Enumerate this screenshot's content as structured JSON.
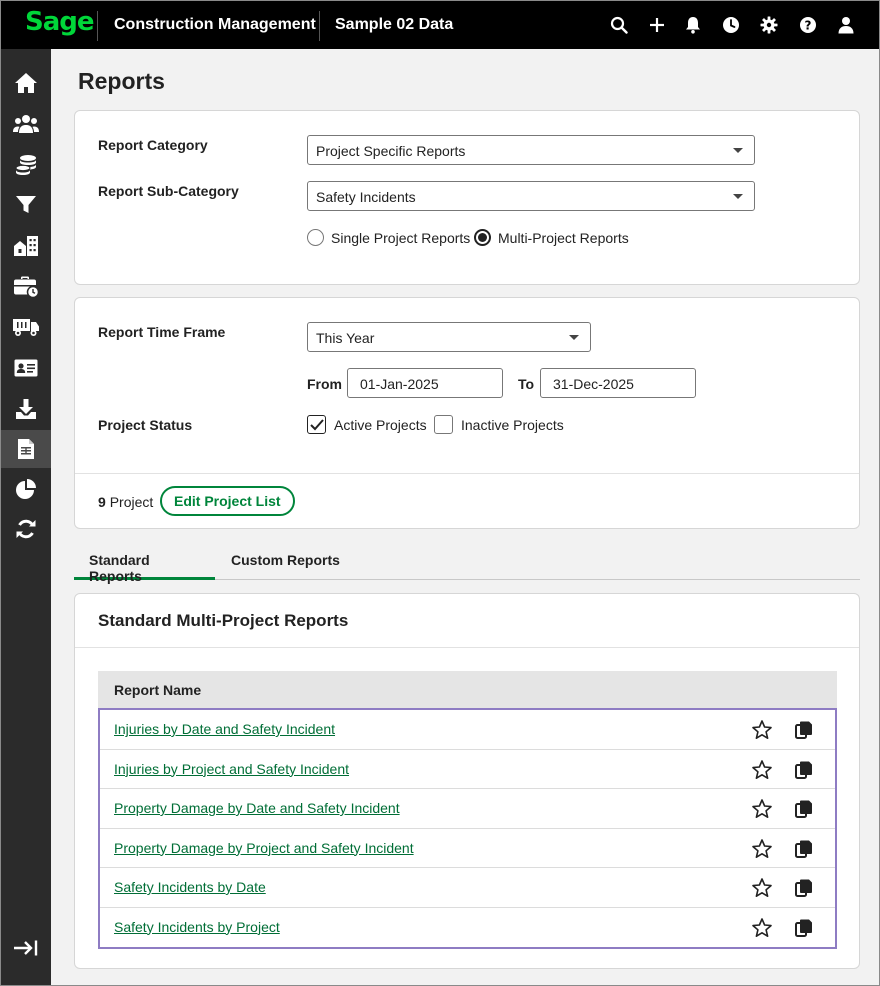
{
  "header": {
    "logo": "Sage",
    "app_name": "Construction Management",
    "company": "Sample 02 Data",
    "icons": [
      "search-icon",
      "plus-icon",
      "bell-icon",
      "clock-icon",
      "gear-icon",
      "help-icon",
      "user-icon"
    ]
  },
  "sidebar": {
    "items": [
      {
        "icon": "home-icon"
      },
      {
        "icon": "people-icon"
      },
      {
        "icon": "coins-icon"
      },
      {
        "icon": "filter-icon"
      },
      {
        "icon": "buildings-icon"
      },
      {
        "icon": "briefcase-clock-icon"
      },
      {
        "icon": "truck-icon"
      },
      {
        "icon": "id-card-icon"
      },
      {
        "icon": "download-icon"
      },
      {
        "icon": "report-icon",
        "active": true
      },
      {
        "icon": "pie-chart-icon"
      },
      {
        "icon": "refresh-icon"
      }
    ],
    "collapse_icon": "collapse-icon"
  },
  "page": {
    "title": "Reports"
  },
  "category_card": {
    "category_label": "Report Category",
    "category_value": "Project Specific Reports",
    "subcategory_label": "Report Sub-Category",
    "subcategory_value": "Safety Incidents",
    "radio_single": "Single Project Reports",
    "radio_multi": "Multi-Project Reports",
    "selected_radio": "Multi-Project Reports"
  },
  "timeframe_card": {
    "timeframe_label": "Report Time Frame",
    "timeframe_value": "This Year",
    "from_label": "From",
    "from_value": "01-Jan-2025",
    "to_label": "To",
    "to_value": "31-Dec-2025",
    "status_label": "Project Status",
    "active_label": "Active Projects",
    "active_checked": true,
    "inactive_label": "Inactive Projects",
    "inactive_checked": false,
    "project_count": "9",
    "project_count_suffix": "Project",
    "edit_button": "Edit Project List"
  },
  "tabs": {
    "standard": "Standard Reports",
    "custom": "Custom Reports",
    "active": "Standard Reports"
  },
  "reports_card": {
    "title": "Standard Multi-Project Reports",
    "column_header": "Report Name",
    "rows": [
      "Injuries by Date and Safety Incident",
      "Injuries by Project and Safety Incident",
      "Property Damage by Date and Safety Incident",
      "Property Damage by Project and Safety Incident",
      "Safety Incidents by Date",
      "Safety Incidents by Project"
    ]
  },
  "colors": {
    "brand_green": "#00d639",
    "accent_green": "#00853b",
    "link_green": "#006e36",
    "highlight_border": "#8e7cc3"
  }
}
